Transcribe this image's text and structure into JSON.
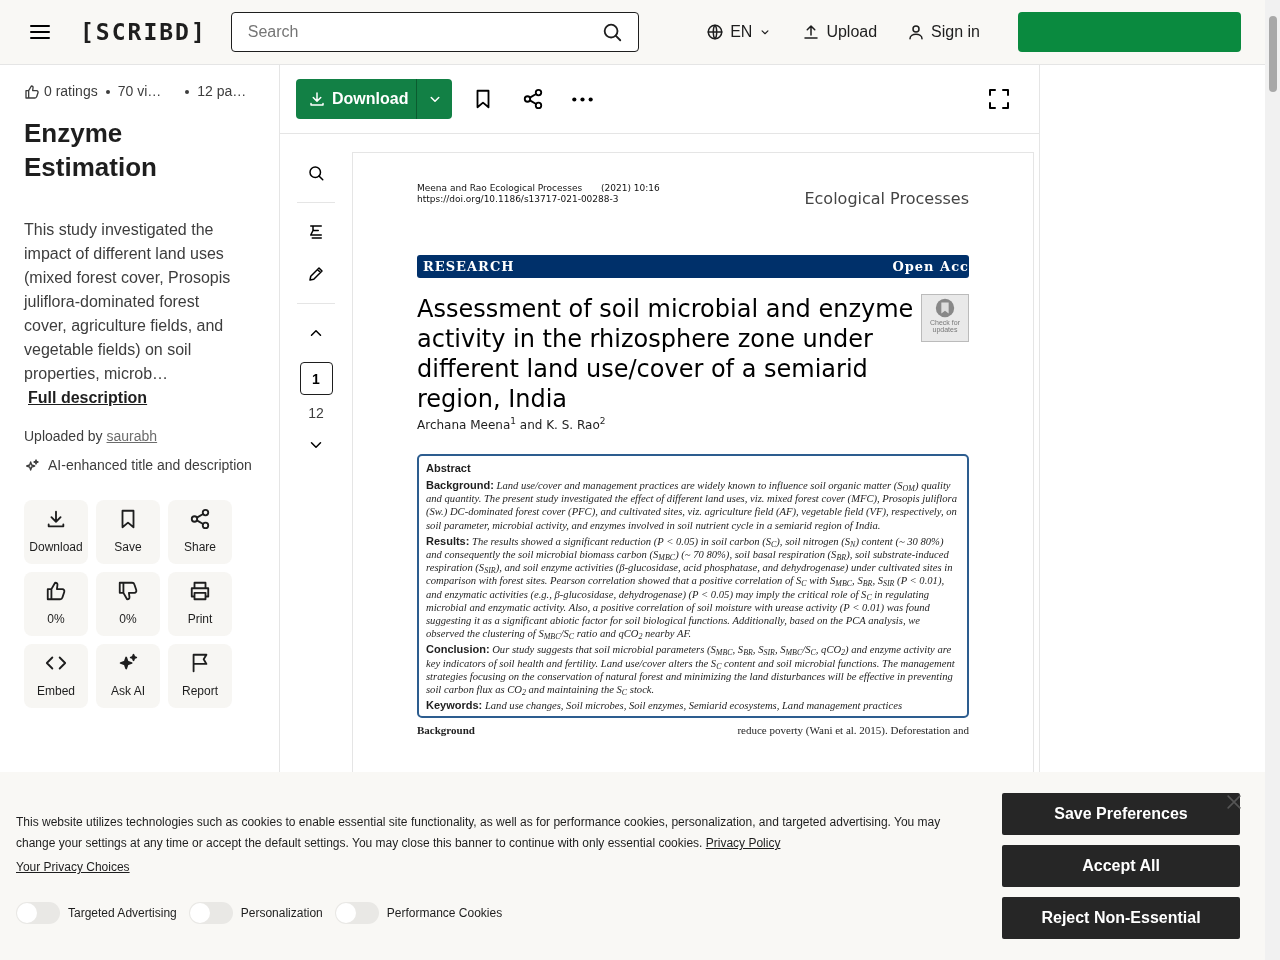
{
  "header": {
    "logo": "[SCRIBD]",
    "search": {
      "placeholder": "Search"
    },
    "language": "EN",
    "upload": "Upload",
    "sign_in": "Sign in"
  },
  "document_info": {
    "ratings": "0 ratings",
    "views": "70 vi…",
    "pages": "12 pa…",
    "title": "Enzyme Estimation",
    "description": "This study investigated the impact of different land uses (mixed forest cover, Prosopis juliflora-dominated forest cover, agriculture fields, and vegetable fields) on soil properties, microb…",
    "full_description": "Full description",
    "uploaded_label": "Uploaded by",
    "uploader": "saurabh",
    "ai_note": "AI-enhanced title and description"
  },
  "actions": [
    {
      "kind": "download",
      "label": "Download"
    },
    {
      "kind": "save",
      "label": "Save"
    },
    {
      "kind": "share",
      "label": "Share"
    },
    {
      "kind": "like",
      "label": "0%"
    },
    {
      "kind": "dislike",
      "label": "0%"
    },
    {
      "kind": "print",
      "label": "Print"
    },
    {
      "kind": "embed",
      "label": "Embed"
    },
    {
      "kind": "ask_ai",
      "label": "Ask AI"
    },
    {
      "kind": "report",
      "label": "Report"
    }
  ],
  "toolbar": {
    "download": "Download"
  },
  "page_nav": {
    "current": "1",
    "total": "12"
  },
  "document_page": {
    "citation": "Meena and Rao Ecological Processes",
    "citation_date": "(2021) 10:16",
    "doi": "https://doi.org/10.1186/s13717-021-00288-3",
    "journal": "Ecological Processes",
    "banner_left": "RESEARCH",
    "banner_right": "Open Acc",
    "title": "Assessment of soil microbial and enzyme activity in the rhizosphere zone under different land use/cover of a semiarid region, India",
    "badge": "Check for updates",
    "authors": "Archana Meena$^{1}$ and K. S. Rao$^{2}$",
    "abstract_heading": "Abstract",
    "abstract": [
      {
        "heading": "Background:",
        "text": "Land use/cover and management practices are widely known to influence soil organic matter (S$_{OM}$) quality and quantity. The present study investigated the effect of different land uses, viz. mixed forest cover (MFC), Prosopis juliflora (Sw.) DC-dominated forest cover (PFC), and cultivated sites, viz. agriculture field (AF), vegetable field (VF), respectively, on soil parameter, microbial activity, and enzymes involved in soil nutrient cycle in a semiarid region of India."
      },
      {
        "heading": "Results:",
        "text": "The results showed a significant reduction (P < 0.05) in soil carbon (S$_{C}$), soil nitrogen (S$_{N}$) content (~ 30 80%) and consequently the soil microbial biomass carbon (S$_{MBC}$) (~ 70 80%), soil basal respiration (S$_{BR}$), soil substrate-induced respiration (S$_{SIR}$), and soil enzyme activities (β-glucosidase, acid phosphatase, and dehydrogenase) under cultivated sites in comparison with forest sites. Pearson correlation showed that a positive correlation of S$_{C}$ with S$_{MBC}$, S$_{BR}$, S$_{SIR}$ (P < 0.01), and enzymatic activities (e.g., β-glucosidase, dehydrogenase) (P < 0.05) may imply the critical role of S$_{C}$ in regulating microbial and enzymatic activity. Also, a positive correlation of soil moisture with urease activity (P < 0.01) was found suggesting it as a significant abiotic factor for soil biological functions. Additionally, based on the PCA analysis, we observed the clustering of S$_{MBC}$/S$_{C}$ ratio and qCO$_{2}$ nearby AF."
      },
      {
        "heading": "Conclusion:",
        "text": "Our study suggests that soil microbial parameters (S$_{MBC}$, S$_{BR}$, S$_{SIR}$, S$_{MBC}$/S$_{C}$, qCO$_{2}$) and enzyme activity are key indicators of soil health and fertility. Land use/cover alters the S$_{C}$ content and soil microbial functions. The management strategies focusing on the conservation of natural forest and minimizing the land disturbances will be effective in preventing soil carbon flux as CO$_{2}$ and maintaining the S$_{C}$ stock."
      },
      {
        "heading": "Keywords:",
        "text": "Land use changes, Soil microbes, Soil enzymes, Semiarid ecosystems, Land management practices"
      }
    ],
    "next_heading": "Background",
    "next_text": "reduce poverty (Wani et al. 2015). Deforestation and"
  },
  "cookie_banner": {
    "text": "This website utilizes technologies such as cookies to enable essential site functionality, as well as for performance cookies, personalization, and targeted advertising. You may change your settings at any time or accept the default settings. You may close this banner to continue with only essential cookies.",
    "privacy_link": "Privacy Policy",
    "choices_link": "Your Privacy Choices",
    "toggles": [
      {
        "label": "Targeted Advertising",
        "on": false
      },
      {
        "label": "Personalization",
        "on": false
      },
      {
        "label": "Performance Cookies",
        "on": false
      }
    ],
    "buttons": [
      "Save Preferences",
      "Accept All",
      "Reject Non-Essential"
    ]
  }
}
